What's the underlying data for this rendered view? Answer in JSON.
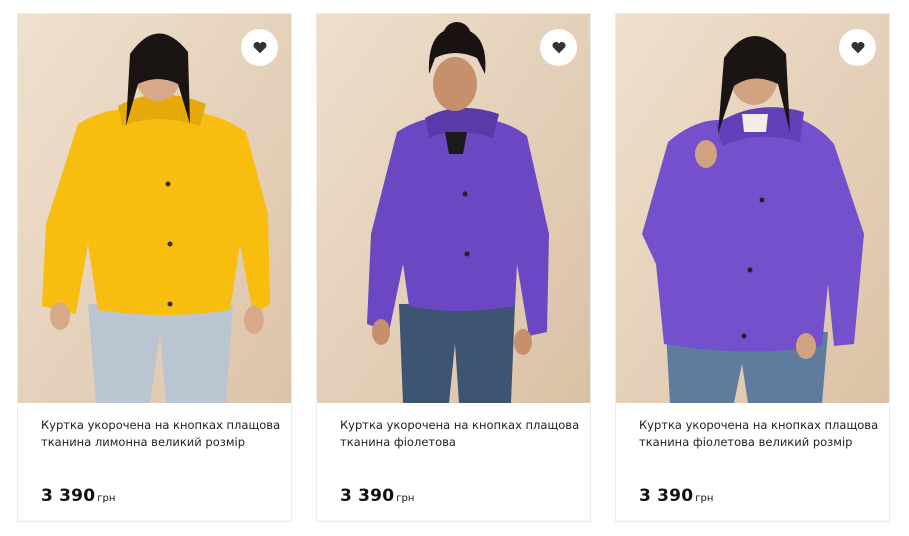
{
  "products": [
    {
      "title": "Куртка укорочена на кнопках плащова тканина лимонна великий розмір",
      "price": "3 390",
      "currency": "грн",
      "jacket_color": "#f7be10",
      "favorite_icon": "heart-icon"
    },
    {
      "title": "Куртка укорочена на кнопках плащова тканина фіолетова",
      "price": "3 390",
      "currency": "грн",
      "jacket_color": "#6b47c4",
      "favorite_icon": "heart-icon"
    },
    {
      "title": "Куртка укорочена на кнопках плащова тканина фіолетова великий розмір",
      "price": "3 390",
      "currency": "грн",
      "jacket_color": "#7550cc",
      "favorite_icon": "heart-icon"
    }
  ],
  "colors": {
    "photo_background": "#e9d7c3",
    "jeans_light": "#b9c6d2",
    "jeans_dark": "#3d5573",
    "heart": "#333333"
  }
}
